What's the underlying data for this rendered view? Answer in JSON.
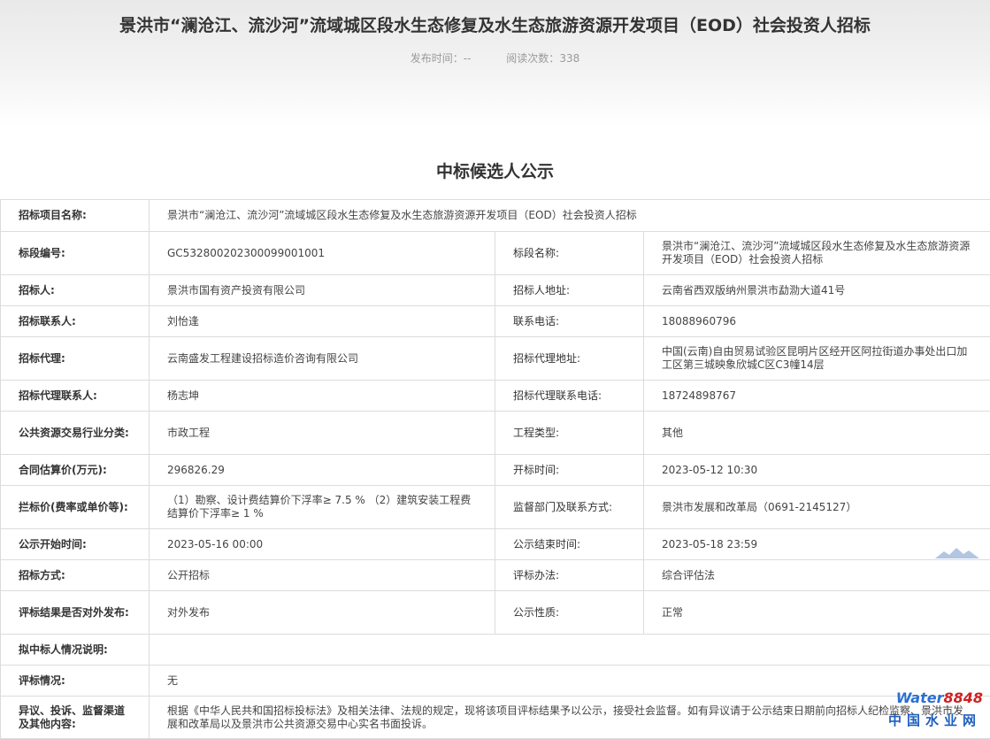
{
  "header": {
    "title": "景洪市“澜沧江、流沙河”流域城区段水生态修复及水生态旅游资源开发项目（EOD）社会投资人招标",
    "publish_time_label": "发布时间：",
    "publish_time": "--",
    "read_count_label": "阅读次数：",
    "read_count": "338"
  },
  "section_title": "中标候选人公示",
  "rows": [
    {
      "k1": "招标项目名称:",
      "v1": "景洪市“澜沧江、流沙河”流域城区段水生态修复及水生态旅游资源开发项目（EOD）社会投资人招标"
    },
    {
      "k1": "标段编号:",
      "v1": "GC5328002023000990 01001",
      "k2": "标段名称:",
      "v2": "景洪市“澜沧江、流沙河”流域城区段水生态修复及水生态旅游资源开发项目（EOD）社会投资人招标"
    },
    {
      "k1": "招标人:",
      "v1": "景洪市国有资产投资有限公司",
      "k2": "招标人地址:",
      "v2": "云南省西双版纳州景洪市勐泐大道41号"
    },
    {
      "k1": "招标联系人:",
      "v1": "刘怡逢",
      "k2": "联系电话:",
      "v2": "18088960796"
    },
    {
      "k1": "招标代理:",
      "v1": "云南盛发工程建设招标造价咨询有限公司",
      "k2": "招标代理地址:",
      "v2": "中国(云南)自由贸易试验区昆明片区经开区阿拉街道办事处出口加工区第三城映象欣城C区C3幢14层"
    },
    {
      "k1": "招标代理联系人:",
      "v1": "杨志坤",
      "k2": "招标代理联系电话:",
      "v2": "18724898767"
    },
    {
      "k1": "公共资源交易行业分类:",
      "v1": "市政工程",
      "k2": "工程类型:",
      "v2": "其他"
    },
    {
      "k1": "合同估算价(万元):",
      "v1": "296826.29",
      "k2": "开标时间:",
      "v2": "2023-05-12 10:30"
    },
    {
      "k1": "拦标价(费率或单价等):",
      "v1": "（1）勘察、设计费结算价下浮率≥ 7.5 % （2）建筑安装工程费结算价下浮率≥ 1 %",
      "k2": "监督部门及联系方式:",
      "v2": "景洪市发展和改革局（0691-2145127）"
    },
    {
      "k1": "公示开始时间:",
      "v1": "2023-05-16 00:00",
      "k2": "公示结束时间:",
      "v2": "2023-05-18 23:59"
    },
    {
      "k1": "招标方式:",
      "v1": "公开招标",
      "k2": "评标办法:",
      "v2": "综合评估法"
    },
    {
      "k1": "评标结果是否对外发布:",
      "v1": "对外发布",
      "k2": "公示性质:",
      "v2": "正常"
    },
    {
      "k1": "拟中标人情况说明:",
      "v1": ""
    },
    {
      "k1": "评标情况:",
      "v1": "无"
    },
    {
      "k1": "异议、投诉、监督渠道及其他内容:",
      "v1": "根据《中华人民共和国招标投标法》及相关法律、法规的规定，现将该项目评标结果予以公示，接受社会监督。如有异议请于公示结束日期前向招标人纪检监察、景洪市发展和改革局以及景洪市公共资源交易中心实名书面投诉。"
    }
  ],
  "watermark": {
    "brand_a": "Water",
    "brand_b": "8848",
    "cn": "中国水业网"
  },
  "colors": {
    "border": "#dcdcdc",
    "header_bg": "#ececec",
    "brand_blue": "#2a6fd1",
    "brand_red": "#d02020"
  }
}
